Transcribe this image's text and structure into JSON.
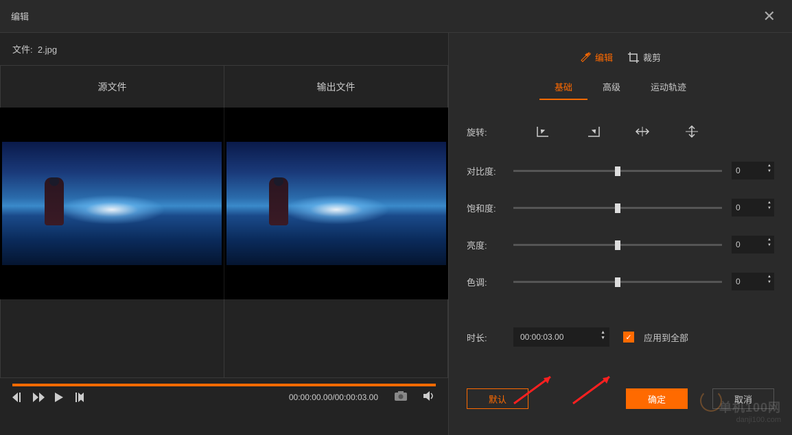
{
  "window": {
    "title": "编辑"
  },
  "file": {
    "label": "文件:",
    "name": "2.jpg"
  },
  "preview": {
    "source_label": "源文件",
    "output_label": "输出文件"
  },
  "playback": {
    "time": "00:00:00.00/00:00:03.00"
  },
  "modes": {
    "edit": "编辑",
    "crop": "裁剪"
  },
  "subtabs": {
    "basic": "基础",
    "advanced": "高级",
    "motion": "运动轨迹"
  },
  "rotate": {
    "label": "旋转:"
  },
  "sliders": {
    "contrast": {
      "label": "对比度:",
      "value": "0"
    },
    "saturation": {
      "label": "饱和度:",
      "value": "0"
    },
    "brightness": {
      "label": "亮度:",
      "value": "0"
    },
    "hue": {
      "label": "色调:",
      "value": "0"
    }
  },
  "duration": {
    "label": "时长:",
    "value": "00:00:03.00",
    "apply_all": "应用到全部"
  },
  "buttons": {
    "default": "默认",
    "ok": "确定",
    "cancel": "取消"
  },
  "watermark": {
    "main": "单机100网",
    "sub": "danji100.com"
  }
}
